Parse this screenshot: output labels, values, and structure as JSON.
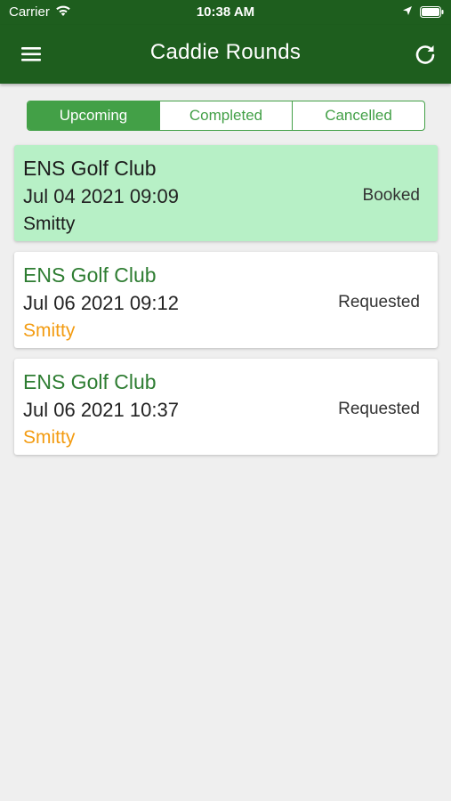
{
  "status_bar": {
    "carrier": "Carrier",
    "time": "10:38 AM"
  },
  "header": {
    "title": "Caddie Rounds",
    "menu_icon": "menu-icon",
    "refresh_icon": "refresh-icon"
  },
  "tabs": [
    {
      "label": "Upcoming",
      "active": true
    },
    {
      "label": "Completed",
      "active": false
    },
    {
      "label": "Cancelled",
      "active": false
    }
  ],
  "rounds": [
    {
      "club": "ENS Golf Club",
      "datetime": "Jul 04 2021 09:09",
      "caddie": "Smitty",
      "status": "Booked"
    },
    {
      "club": "ENS Golf Club",
      "datetime": "Jul 06 2021 09:12",
      "caddie": "Smitty",
      "status": "Requested"
    },
    {
      "club": "ENS Golf Club",
      "datetime": "Jul 06 2021 10:37",
      "caddie": "Smitty",
      "status": "Requested"
    }
  ],
  "colors": {
    "header_bg": "#1e5e1e",
    "accent": "#43a047",
    "booked_bg": "#b7f0c6",
    "club_text_default": "#2e7d32",
    "caddie_text_pending": "#f39c12"
  }
}
